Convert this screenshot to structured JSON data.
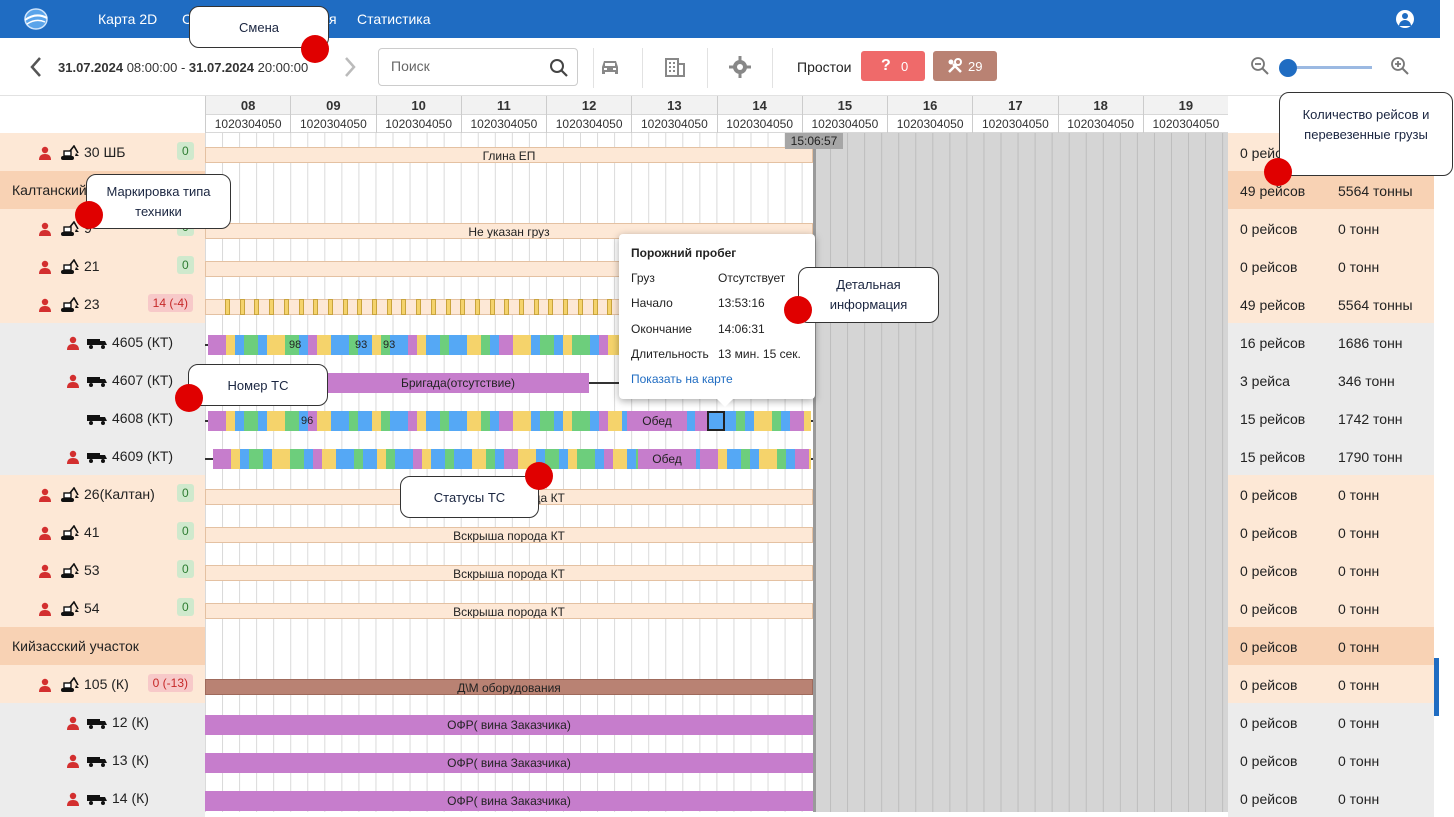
{
  "nav": {
    "links": [
      "Карта 2D",
      "С",
      "я",
      "Статистика"
    ]
  },
  "toolbar": {
    "date_from": "31.07.2024",
    "time_from": "08:00:00",
    "sep": "-",
    "date_to": "31.07.2024",
    "time_to": "20:00:00",
    "search_placeholder": "Поиск",
    "idle_label": "Простои",
    "idle_red_count": "0",
    "idle_brown_count": "29"
  },
  "timeline": {
    "hours": [
      "08",
      "09",
      "10",
      "11",
      "12",
      "13",
      "14",
      "15",
      "16",
      "17",
      "18",
      "19"
    ],
    "minutes": [
      "1020304050",
      "1020304050",
      "1020304050",
      "1020304050",
      "1020304050",
      "1020304050",
      "1020304050",
      "1020304050",
      "1020304050",
      "1020304050",
      "1020304050",
      "1020304050"
    ],
    "now": "15:06:57"
  },
  "rows": [
    {
      "kind": "excavator",
      "name": "30 ШБ",
      "count": "0",
      "count_color": "g",
      "bar": "Глина ЕП",
      "trips": "0 рейсов",
      "tons": ""
    },
    {
      "kind": "group",
      "name": "Калтанский",
      "trips": "49 рейсов",
      "tons": "5564 тонны"
    },
    {
      "kind": "excavator",
      "name": "9",
      "count": "0",
      "count_color": "g",
      "bar": "Не указан груз",
      "trips": "0 рейсов",
      "tons": "0 тонн"
    },
    {
      "kind": "excavator",
      "name": "21",
      "count": "0",
      "count_color": "g",
      "bar": "",
      "trips": "0 рейсов",
      "tons": "0 тонн"
    },
    {
      "kind": "excavator",
      "name": "23",
      "count": "14 (-4)",
      "count_color": "r",
      "bar": "",
      "trips": "49 рейсов",
      "tons": "5564 тонны"
    },
    {
      "kind": "truck",
      "name": "4605 (КТ)",
      "person": true,
      "labels": [
        "98",
        "93",
        "93"
      ],
      "trips": "16 рейсов",
      "tons": "1686 тонн"
    },
    {
      "kind": "truck",
      "name": "4607 (КТ)",
      "person": true,
      "bar": "Бригада(отсутствие)",
      "trips": "3 рейса",
      "tons": "346 тонн"
    },
    {
      "kind": "truck",
      "name": "4608 (КТ)",
      "person": false,
      "labels": [
        "96"
      ],
      "bar": "Обед",
      "trips": "15 рейсов",
      "tons": "1742 тонн"
    },
    {
      "kind": "truck",
      "name": "4609 (КТ)",
      "person": true,
      "bar": "Обед",
      "trips": "15 рейсов",
      "tons": "1790 тонн"
    },
    {
      "kind": "excavator",
      "name": "26(Калтан)",
      "count": "0",
      "count_color": "g",
      "bar": "Вскрыша порода КТ",
      "trips": "0 рейсов",
      "tons": "0 тонн"
    },
    {
      "kind": "excavator",
      "name": "41",
      "count": "0",
      "count_color": "g",
      "bar": "Вскрыша порода КТ",
      "trips": "0 рейсов",
      "tons": "0 тонн"
    },
    {
      "kind": "excavator",
      "name": "53",
      "count": "0",
      "count_color": "g",
      "bar": "Вскрыша порода КТ",
      "trips": "0 рейсов",
      "tons": "0 тонн"
    },
    {
      "kind": "excavator",
      "name": "54",
      "count": "0",
      "count_color": "g",
      "bar": "Вскрыша порода КТ",
      "trips": "0 рейсов",
      "tons": "0 тонн"
    },
    {
      "kind": "group",
      "name": "Кийзасский участок",
      "trips": "0 рейсов",
      "tons": "0 тонн"
    },
    {
      "kind": "excavator",
      "name": "105 (К)",
      "count": "0 (-13)",
      "count_color": "r",
      "bar": "Д\\М оборудования",
      "trips": "0 рейсов",
      "tons": "0 тонн"
    },
    {
      "kind": "truck",
      "name": "12 (К)",
      "person": true,
      "bar": "ОФР( вина Заказчика)",
      "trips": "0 рейсов",
      "tons": "0 тонн"
    },
    {
      "kind": "truck",
      "name": "13 (К)",
      "person": true,
      "bar": "ОФР( вина Заказчика)",
      "trips": "0 рейсов",
      "tons": "0 тонн"
    },
    {
      "kind": "truck",
      "name": "14 (К)",
      "person": true,
      "bar": "ОФР( вина Заказчика)",
      "trips": "0 рейсов",
      "tons": "0 тонн"
    }
  ],
  "popup": {
    "title": "Порожний пробег",
    "cargo_k": "Груз",
    "cargo_v": "Отсутствует",
    "start_k": "Начало",
    "start_v": "13:53:16",
    "end_k": "Окончание",
    "end_v": "14:06:31",
    "dur_k": "Длительность",
    "dur_v": "13 мин. 15 сек.",
    "link": "Показать на карте"
  },
  "callouts": {
    "shift": "Смена",
    "marking": "Маркировка типа техники",
    "vehicle_no": "Номер ТС",
    "statuses": "Статусы ТС",
    "details": "Детальная информация",
    "trips_info": "Количество рейсов и перевезенные грузы"
  },
  "colors": {
    "nav": "#1f6cc2",
    "loading": "#f5d36b",
    "unloading": "#6dce7c",
    "moving": "#55a8f5",
    "idle": "#c67dcc",
    "repair": "#b98273",
    "group_bg": "#f8d2b4",
    "excavator_bg": "#fde8d6",
    "truck_bg": "#ececec"
  }
}
